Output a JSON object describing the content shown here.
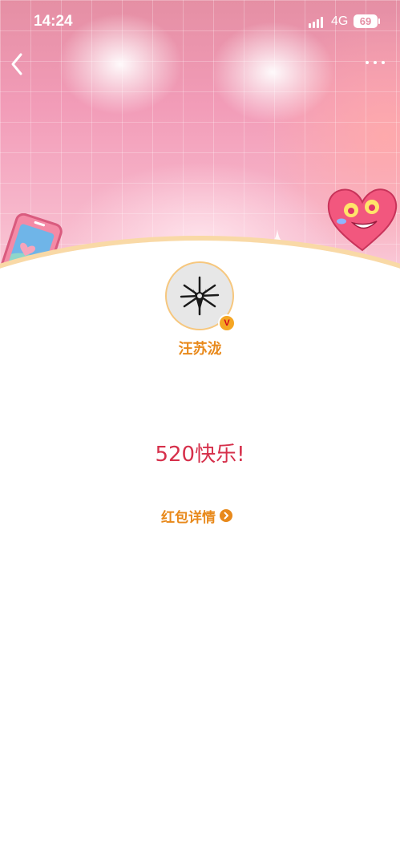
{
  "status_bar": {
    "time": "14:24",
    "network": "4G",
    "battery": "69",
    "icons": [
      "signal-icon",
      "battery-icon"
    ]
  },
  "nav": {
    "back_icon": "chevron-left-icon",
    "more_icon": "more-dots-icon"
  },
  "profile": {
    "name": "汪苏泷",
    "verified_badge": "V"
  },
  "red_packet": {
    "message": "520快乐!",
    "details_label": "红包详情",
    "details_icon": "chevron-right-circle-icon"
  },
  "colors": {
    "accent_orange": "#e8891b",
    "message_red": "#d6304b",
    "banner_pink": "#f29cb8"
  }
}
